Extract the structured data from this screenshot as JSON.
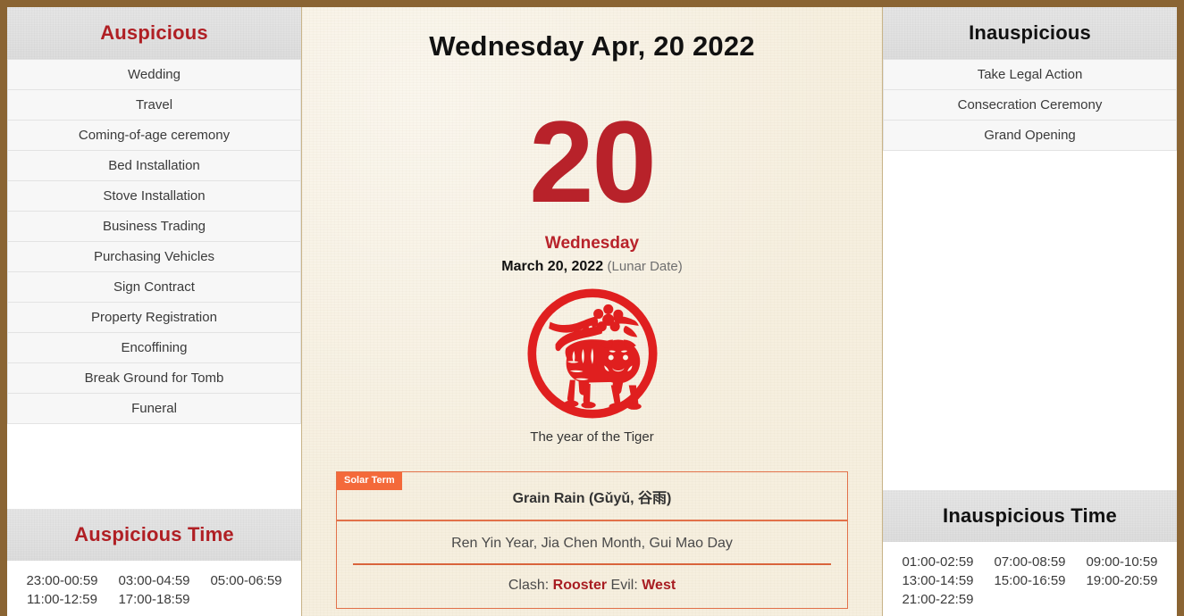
{
  "left_panel": {
    "header": "Auspicious",
    "header_color": "#b01f24",
    "items": [
      "Wedding",
      "Travel",
      "Coming-of-age ceremony",
      "Bed Installation",
      "Stove Installation",
      "Business Trading",
      "Purchasing Vehicles",
      "Sign Contract",
      "Property Registration",
      "Encoffining",
      "Break Ground for Tomb",
      "Funeral"
    ],
    "time_header": "Auspicious Time",
    "times": [
      "23:00-00:59",
      "03:00-04:59",
      "05:00-06:59",
      "11:00-12:59",
      "17:00-18:59"
    ]
  },
  "center_panel": {
    "title": "Wednesday Apr, 20 2022",
    "day_number": "20",
    "weekday": "Wednesday",
    "lunar_date": "March 20, 2022",
    "lunar_note": "(Lunar Date)",
    "zodiac_caption": "The year of the Tiger",
    "zodiac_icon": "tiger-papercut-icon",
    "solar_term_badge": "Solar Term",
    "solar_term_name": "Grain Rain (Gǔyǔ, 谷雨)",
    "ganzhi": "Ren Yin Year, Jia Chen Month, Gui Mao Day",
    "clash_prefix": "Clash:",
    "clash_value": "Rooster",
    "evil_prefix": "Evil:",
    "evil_value": "West",
    "accent_color": "#e2714a",
    "day_color": "#b8222a"
  },
  "right_panel": {
    "header": "Inauspicious",
    "header_color": "#111111",
    "items": [
      "Take Legal Action",
      "Consecration Ceremony",
      "Grand Opening"
    ],
    "time_header": "Inauspicious Time",
    "times": [
      "01:00-02:59",
      "07:00-08:59",
      "09:00-10:59",
      "13:00-14:59",
      "15:00-16:59",
      "19:00-20:59",
      "21:00-22:59"
    ]
  }
}
